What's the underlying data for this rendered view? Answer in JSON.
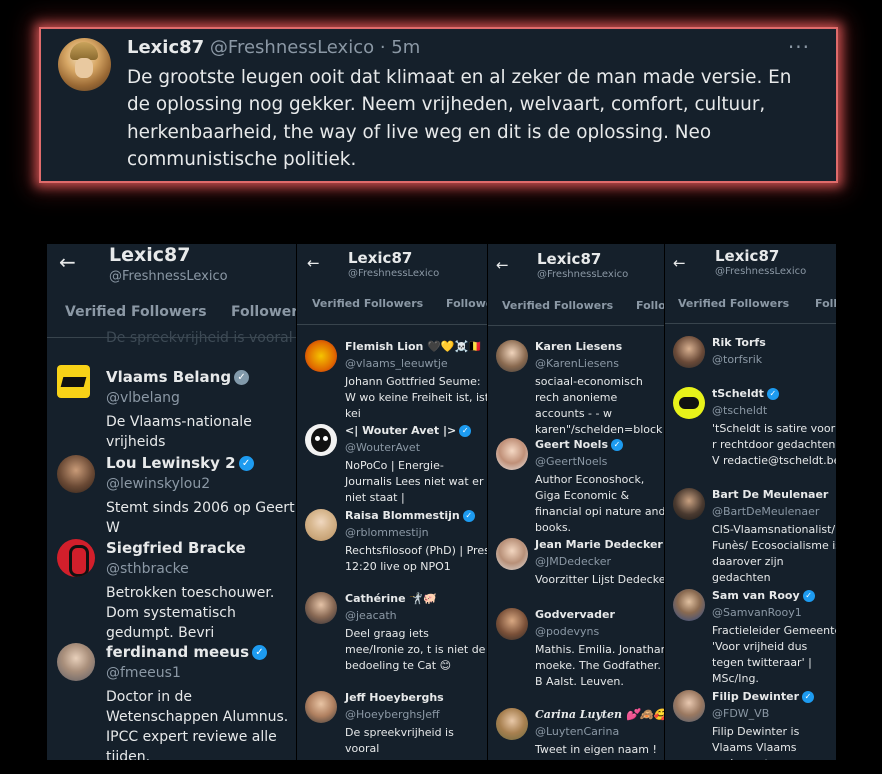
{
  "tweet": {
    "name": "Lexic87",
    "handle": "@FreshnessLexico",
    "time": "· 5m",
    "more": "···",
    "text": "De grootste leugen ooit dat klimaat en al zeker de man made versie. En de oplossing nog gekker. Neem vrijheden, welvaart, comfort, cultuur, herkenbaarheid, the way of live weg en dit is de oplossing. Neo communistische politiek."
  },
  "profile": {
    "back": "←",
    "name": "Lexic87",
    "handle": "@FreshnessLexico",
    "tab_verified": "Verified Followers",
    "tab_followers": "Followers",
    "tab_followers_cut2": "Followe",
    "tab_followers_cut3": "Follo",
    "tab_followers_cut4": "Foll"
  },
  "panel1": {
    "faded_top": "De spreekvrijheid is vooral",
    "entries": [
      {
        "name": "Vlaams Belang",
        "handle": "@vlbelang",
        "bio": "De Vlaams-nationale vrijheids",
        "verified": "gray"
      },
      {
        "name": "Lou Lewinsky 2",
        "handle": "@lewinskylou2",
        "bio": "Stemt sinds 2006 op Geert W",
        "verified": "blue"
      },
      {
        "name": "Siegfried Bracke",
        "handle": "@sthbracke",
        "bio": "Betrokken toeschouwer. Dom systematisch gedumpt. Bevri",
        "verified": ""
      },
      {
        "name": "ferdinand meeus",
        "handle": "@fmeeus1",
        "bio": "Doctor in de Wetenschappen Alumnus. IPCC expert reviewe alle tijden.",
        "verified": "blue"
      }
    ]
  },
  "panel2": {
    "entries": [
      {
        "name": "Flemish Lion 🖤💛☠️🇧🇪",
        "handle": "@vlaams_leeuwtje",
        "bio": "Johann Gottfried Seume: W wo keine Freiheit ist, ist kei",
        "verified": ""
      },
      {
        "name": "<| Wouter Avet |>",
        "handle": "@WouterAvet",
        "bio": "NoPoCo | Energie-Journalis Lees niet wat er niet staat |",
        "verified": "blue"
      },
      {
        "name": "Raisa Blommestijn",
        "handle": "@rblommestijn",
        "bio": "Rechtsfilosoof (PhD) | Pres 12:20 live op NPO1",
        "verified": "blue"
      },
      {
        "name": "Cathérine 🤺🐖",
        "handle": "@jeacath",
        "bio": "Deel graag iets mee/Ironie zo, t is niet de bedoeling te Cat 😊",
        "verified": ""
      },
      {
        "name": "Jeff Hoeyberghs",
        "handle": "@HoeyberghsJeff",
        "bio": "De spreekvrijheid is vooral",
        "verified": ""
      }
    ]
  },
  "panel3": {
    "entries": [
      {
        "name": "Karen Liesens",
        "handle": "@KarenLiesens",
        "bio": "sociaal-economisch rech anonieme accounts - - w karen\"/schelden=block",
        "verified": ""
      },
      {
        "name": "Geert Noels",
        "handle": "@GeertNoels",
        "bio": "Author Econoshock, Giga Economic & financial opi nature and books.",
        "verified": "blue"
      },
      {
        "name": "Jean Marie Dedecker",
        "handle": "@JMDedecker",
        "bio": "Voorzitter Lijst Dedecker",
        "verified": ""
      },
      {
        "name": "Godvervader",
        "handle": "@podevyns",
        "bio": "Mathis. Emilia. Jonathan moeke. The Godfather. B Aalst. Leuven.",
        "verified": ""
      },
      {
        "name": "Carina Luyten 💕🙈🥰",
        "handle": "@LuytenCarina",
        "bio": "Tweet in eigen naam !",
        "verified": ""
      }
    ]
  },
  "panel4": {
    "entries": [
      {
        "name": "Rik Torfs",
        "handle": "@torfsrik",
        "bio": "",
        "verified": ""
      },
      {
        "name": "tScheldt",
        "handle": "@tscheldt",
        "bio": "'tScheldt is satire voor r rechtdoor gedachten, V redactie@tscheldt.be",
        "verified": "blue"
      },
      {
        "name": "Bart De Meulenaer",
        "handle": "@BartDeMeulenaer",
        "bio": "CIS-Vlaamsnationalist/ Funès/ Ecosocialisme is daarover zijn gedachten",
        "verified": ""
      },
      {
        "name": "Sam van Rooy",
        "handle": "@SamvanRooy1",
        "bio": "Fractieleider Gemeente 'Voor vrijheid dus tegen twitteraar' | MSc/Ing.",
        "verified": "blue"
      },
      {
        "name": "Filip Dewinter",
        "handle": "@FDW_VB",
        "bio": "Filip Dewinter is Vlaams Vlaams parlement en ra",
        "verified": "blue"
      }
    ]
  },
  "colors": {
    "accent": "#1d9bf0",
    "bg": "#15202b",
    "glow": "#e06b6b"
  }
}
